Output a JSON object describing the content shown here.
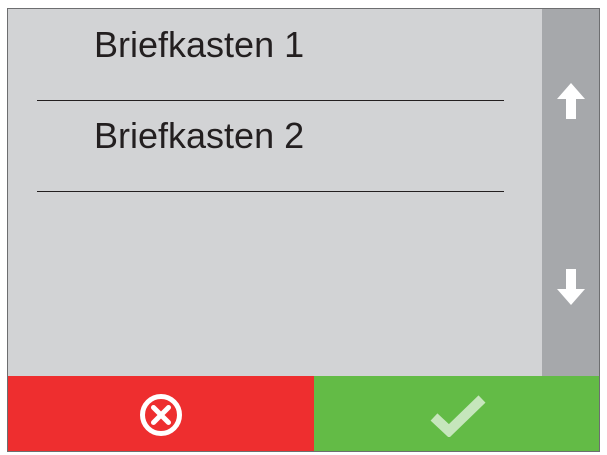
{
  "mailboxes": {
    "items": [
      {
        "label": "Briefkasten 1"
      },
      {
        "label": "Briefkasten 2"
      }
    ]
  },
  "scrollbar": {
    "up_icon": "arrow-up-icon",
    "down_icon": "arrow-down-icon"
  },
  "actions": {
    "cancel": {
      "icon": "close-circle-icon",
      "color": "#ee2e2f"
    },
    "confirm": {
      "icon": "checkmark-icon",
      "color": "#63bb46"
    }
  },
  "colors": {
    "list_background": "#d2d3d5",
    "scrollbar_background": "#a6a8ab",
    "text": "#231f20"
  }
}
